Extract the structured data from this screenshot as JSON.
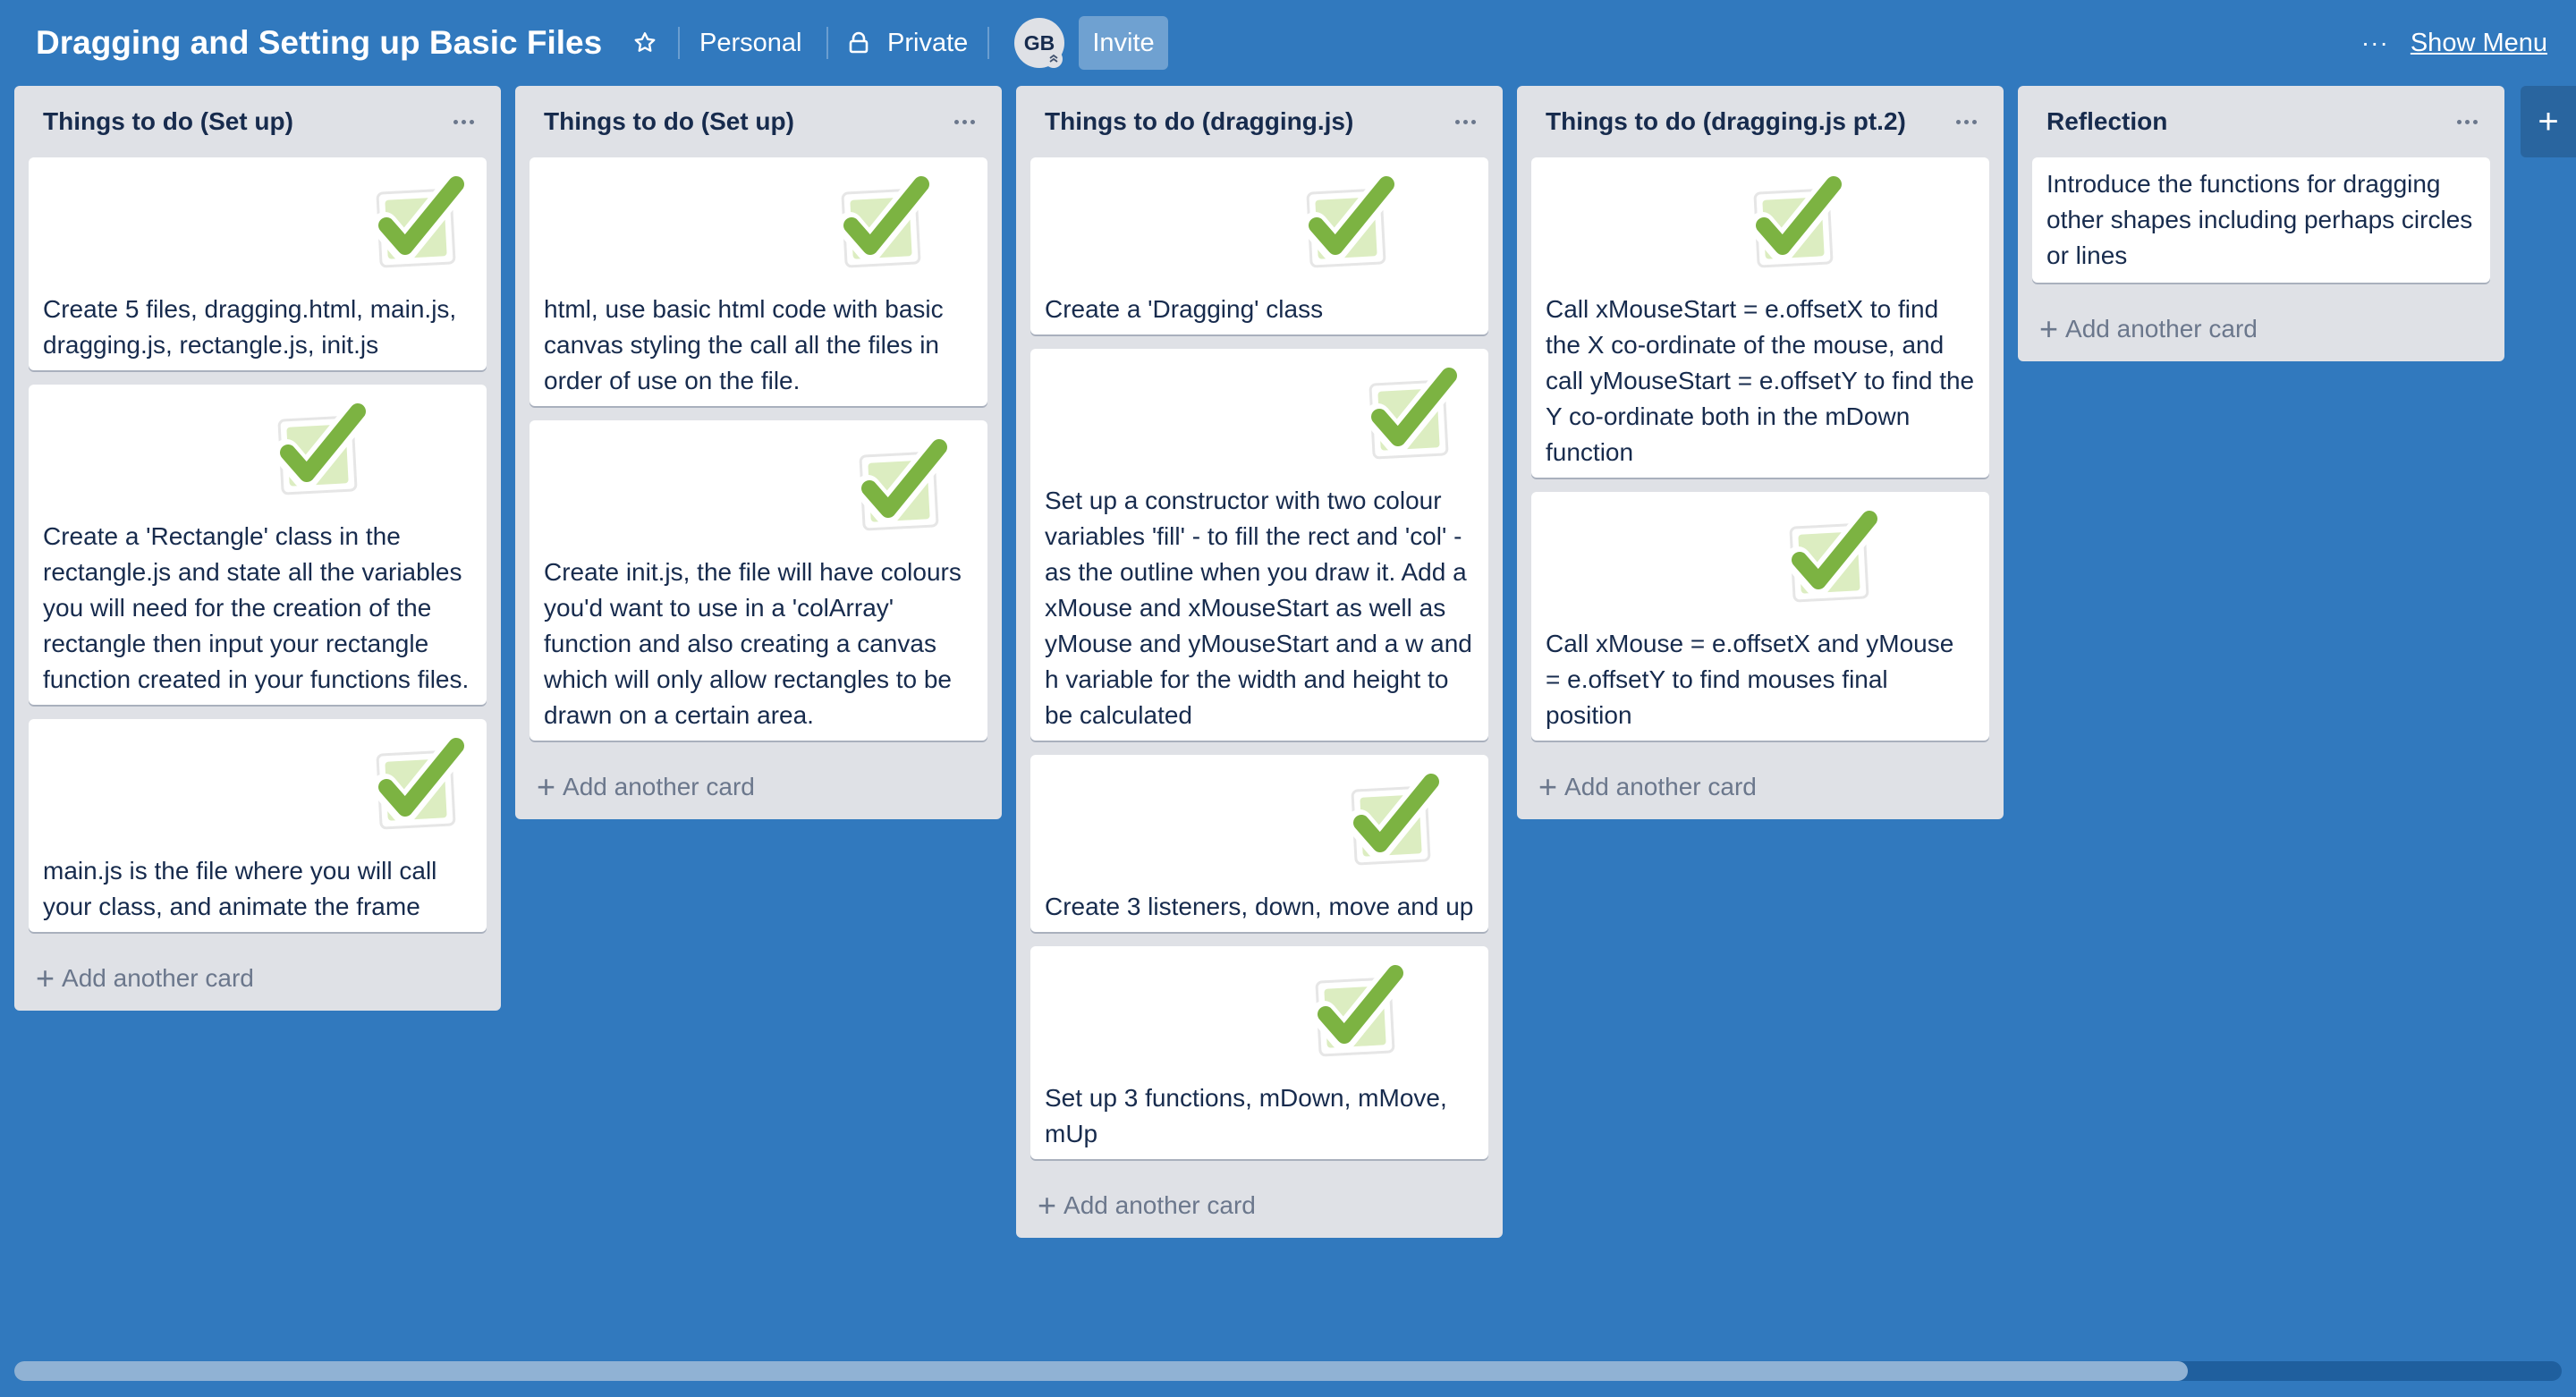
{
  "board": {
    "title": "Dragging and Setting up Basic Files",
    "team": "Personal",
    "visibility": "Private",
    "member_initials": "GB",
    "invite_label": "Invite",
    "show_menu_label": "Show Menu",
    "add_list_label": "+"
  },
  "icons": {
    "star": "star-icon",
    "visibility": "lock-icon",
    "list_menu": "ellipsis-icon",
    "card_sticker": "checkmark-sticker-icon"
  },
  "colors": {
    "board_background": "#3179be",
    "list_background": "#dfe1e6",
    "card_background": "#ffffff",
    "check_green": "#7cb342"
  },
  "lists": [
    {
      "title": "Things to do (Set up)",
      "cards": [
        {
          "text": "Create 5 files, dragging.html, main.js, dragging.js, rectangle.js, init.js"
        },
        {
          "text": "Create a 'Rectangle' class in the rectangle.js and state all the variables you will need for the creation of the rectangle then input your rectangle function created in your functions files."
        },
        {
          "text": "main.js is the file where you will call your class, and animate the frame"
        }
      ],
      "add_card_label": "Add another card"
    },
    {
      "title": "Things to do (Set up)",
      "cards": [
        {
          "text": "html, use basic html code with basic canvas styling the call all the files in order of use on the file."
        },
        {
          "text": "Create init.js, the file will have colours you'd want to use in a 'colArray' function and also creating a canvas which will only allow rectangles to be drawn on a certain area."
        }
      ],
      "add_card_label": "Add another card"
    },
    {
      "title": "Things to do (dragging.js)",
      "cards": [
        {
          "text": "Create a 'Dragging' class"
        },
        {
          "text": "Set up a constructor with two colour variables 'fill' - to fill the rect and 'col' - as the outline when you draw it. Add a xMouse and xMouseStart as well as yMouse and yMouseStart and a w and h variable for the width and height to be calculated"
        },
        {
          "text": "Create 3 listeners, down, move and up"
        },
        {
          "text": "Set up 3 functions, mDown, mMove, mUp"
        }
      ],
      "add_card_label": "Add another card"
    },
    {
      "title": "Things to do (dragging.js pt.2)",
      "cards": [
        {
          "text": "Call xMouseStart = e.offsetX to find the X co-ordinate of the mouse, and call yMouseStart = e.offsetY to find the Y co-ordinate both in the mDown function"
        },
        {
          "text": "Call xMouse = e.offsetX and yMouse = e.offsetY to find mouses final position"
        }
      ],
      "add_card_label": "Add another card"
    },
    {
      "title": "Reflection",
      "cards": [
        {
          "text": "Introduce the functions for dragging other shapes including perhaps circles or lines"
        }
      ],
      "add_card_label": "Add another card"
    }
  ]
}
